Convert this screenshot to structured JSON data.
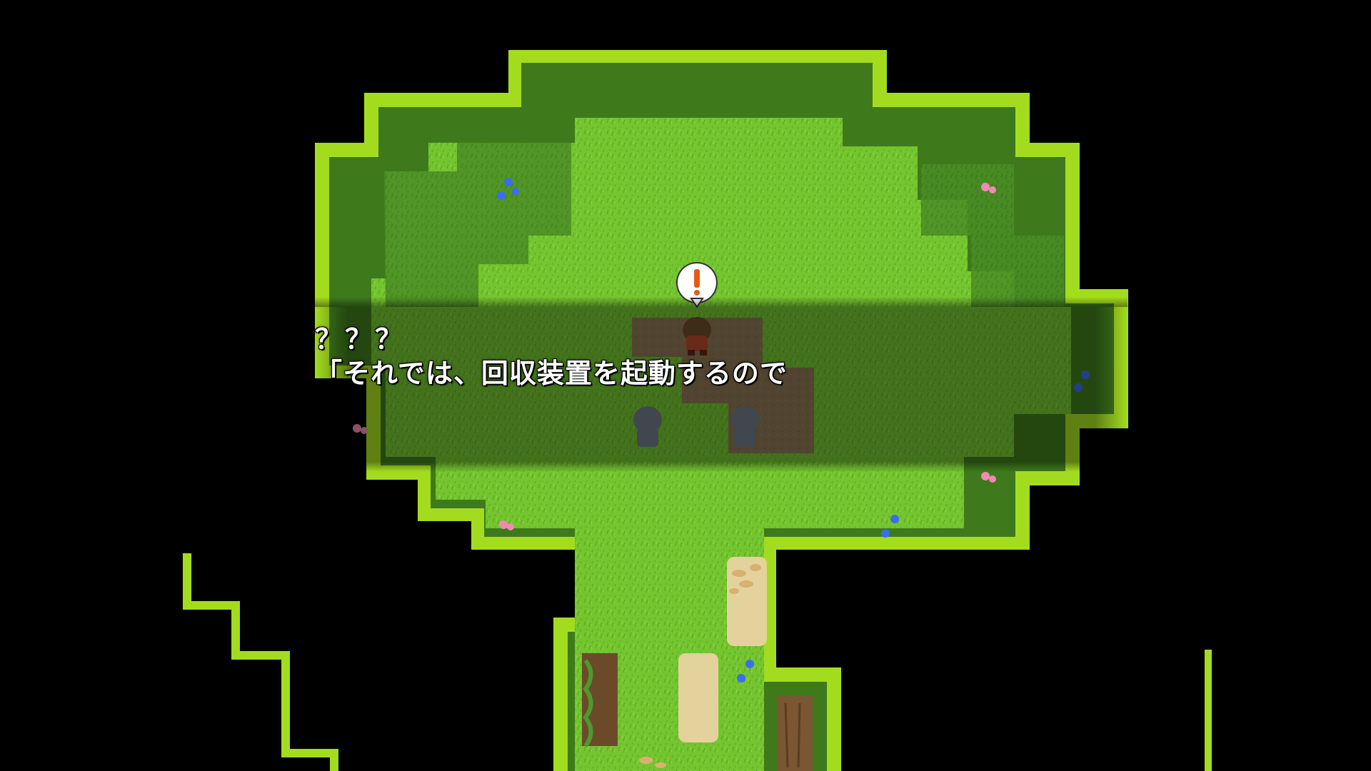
{
  "scene": {
    "background_color": "#000000",
    "grass_color": "#6fbf2e",
    "grass_light_color": "#86d23a",
    "grass_dark_color": "#3f7a1f",
    "hedge_color": "#a8e023",
    "dirt_color": "#7a6a49",
    "sand_color": "#e0cf9a"
  },
  "player": {
    "icon": "balloon-exclamation-icon"
  },
  "dialog": {
    "speaker": "？？？",
    "lines": [
      "「それでは、回収装置を起動するので"
    ]
  }
}
